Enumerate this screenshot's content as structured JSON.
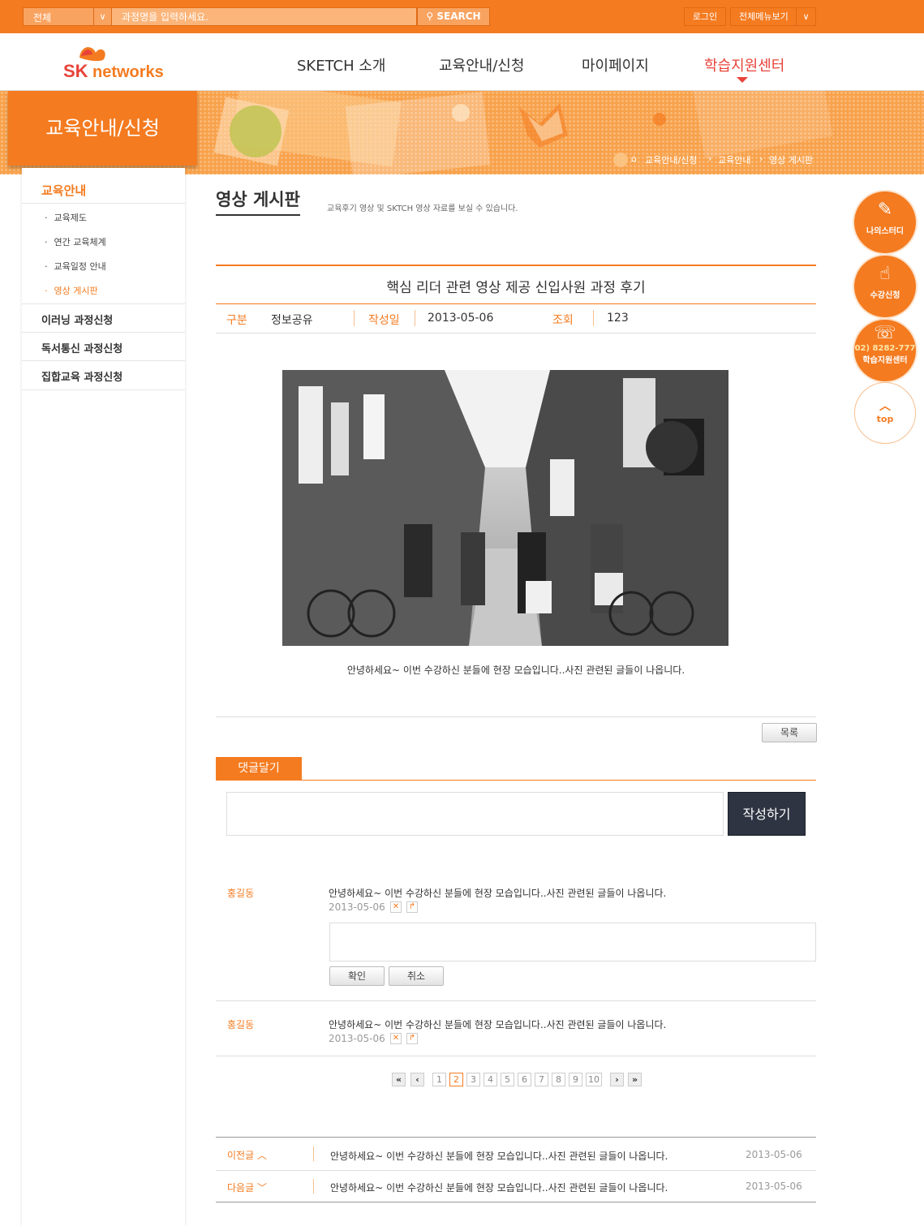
{
  "top": {
    "category": "전체",
    "search_placeholder": "과정명을 입력하세요.",
    "search_btn": "SEARCH",
    "login": "로그인",
    "allmenu": "전체메뉴보기"
  },
  "logo": {
    "sk": "SK",
    "networks": "networks"
  },
  "gnb": [
    "SKETCH 소개",
    "교육안내/신청",
    "마이페이지",
    "학습지원센터"
  ],
  "section_title": "교육안내/신청",
  "breadcrumb": [
    "교육안내/신청",
    "교육안내",
    "영상 게시판"
  ],
  "lnb": {
    "heading": "교육안내",
    "subs": [
      "교육제도",
      "연간 교육체계",
      "교육일정 안내",
      "영상 게시판"
    ],
    "menus": [
      "이러닝 과정신청",
      "독서통신 과정신청",
      "집합교육 과정신청"
    ]
  },
  "page": {
    "title": "영상 게시판",
    "desc": "교육후기 영상 및 SKTCH 영상 자료를 보실 수 있습니다."
  },
  "article": {
    "title": "핵심 리더 관련 영상 제공 신입사원 과정 후기",
    "cat_label": "구분",
    "cat": "정보공유",
    "date_label": "작성일",
    "date": "2013-05-06",
    "views_label": "조회",
    "views": "123",
    "caption": "안녕하세요~ 이번 수강하신 분들에 현장 모습입니다..사진 관련된 글들이 나옵니다."
  },
  "list_btn": "목록",
  "comment": {
    "tab": "댓글달기",
    "submit": "작성하기",
    "items": [
      {
        "name": "홍길동",
        "text": "안녕하세요~ 이번 수강하신 분들에 현장 모습입니다..사진 관련된 글들이 나옵니다.",
        "date": "2013-05-06"
      },
      {
        "name": "홍길동",
        "text": "안녕하세요~ 이번 수강하신 분들에 현장 모습입니다..사진 관련된 글들이 나옵니다.",
        "date": "2013-05-06"
      }
    ],
    "confirm": "확인",
    "cancel": "취소"
  },
  "pagination": {
    "first": "«",
    "prev": "‹",
    "pages": [
      "1",
      "2",
      "3",
      "4",
      "5",
      "6",
      "7",
      "8",
      "9",
      "10"
    ],
    "current": "2",
    "next": "›",
    "last": "»"
  },
  "prevnext": [
    {
      "label": "이전글",
      "text": "안녕하세요~ 이번 수강하신 분들에 현장 모습입니다..사진 관련된 글들이 나옵니다.",
      "date": "2013-05-06"
    },
    {
      "label": "다음글",
      "text": "안녕하세요~ 이번 수강하신 분들에 현장 모습입니다..사진 관련된 글들이 나옵니다.",
      "date": "2013-05-06"
    }
  ],
  "quick": {
    "study": "나의스터디",
    "apply": "수강신청",
    "phone": "02) 8282-777",
    "center": "학습지원센터",
    "top": "top"
  },
  "colors": {
    "accent": "#f47b20",
    "gnb_active": "#e8433a",
    "dark_button": "#2e3442"
  }
}
